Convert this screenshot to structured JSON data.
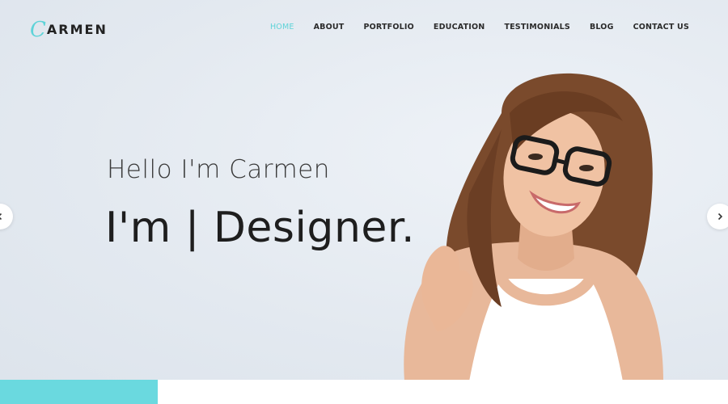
{
  "brand": {
    "logo_initial": "C",
    "logo_rest": "ARMEN"
  },
  "nav": {
    "items": [
      {
        "label": "HOME",
        "active": true
      },
      {
        "label": "ABOUT",
        "active": false
      },
      {
        "label": "PORTFOLIO",
        "active": false
      },
      {
        "label": "EDUCATION",
        "active": false
      },
      {
        "label": "TESTIMONIALS",
        "active": false
      },
      {
        "label": "BLOG",
        "active": false
      },
      {
        "label": "CONTACT US",
        "active": false
      }
    ]
  },
  "hero": {
    "greeting": "Hello I'm Carmen",
    "role_line": "I'm | Designer."
  },
  "slider": {
    "prev_icon": "chevron-left-icon",
    "next_icon": "chevron-right-icon"
  },
  "colors": {
    "accent": "#5fd3d8",
    "bottom_accent": "#6ad9df",
    "text_dark": "#1e1e1e",
    "background": "#e3e9f0"
  }
}
